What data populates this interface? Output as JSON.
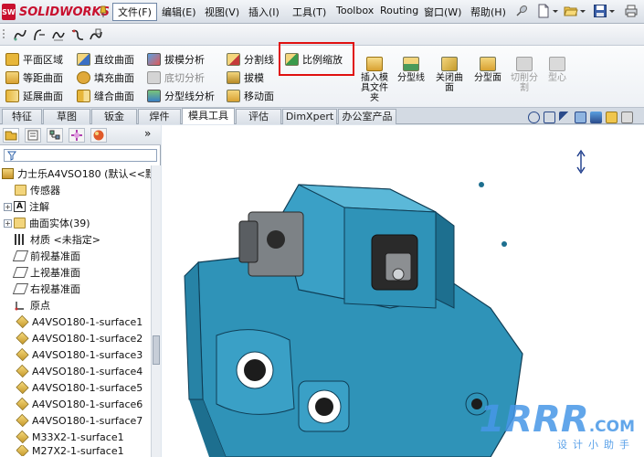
{
  "app": {
    "logo_text": "SOLIDWORKS",
    "logo_mark": "SW"
  },
  "menu": [
    {
      "label": "文件(F)",
      "active": true
    },
    {
      "label": "编辑(E)"
    },
    {
      "label": "视图(V)"
    },
    {
      "label": "插入(I)"
    },
    {
      "label": "工具(T)"
    },
    {
      "label": "Toolbox"
    },
    {
      "label": "Routing"
    },
    {
      "label": "窗口(W)"
    },
    {
      "label": "帮助(H)"
    }
  ],
  "commands": {
    "col1": [
      "平面区域",
      "等距曲面",
      "延展曲面"
    ],
    "col2": [
      "直纹曲面",
      "填充曲面",
      "缝合曲面"
    ],
    "col3": [
      "拔模分析",
      "底切分析",
      "分型线分析"
    ],
    "col4": [
      "分割线",
      "拔模",
      "移动面"
    ],
    "scale": "比例缩放",
    "vertical": [
      {
        "label": "插入模具文件夹",
        "lines": [
          "插入模",
          "具文件",
          "夹"
        ]
      },
      {
        "label": "分型线",
        "lines": [
          "分型线"
        ]
      },
      {
        "label": "关闭曲面",
        "lines": [
          "关闭曲",
          "面"
        ]
      },
      {
        "label": "分型面",
        "lines": [
          "分型面"
        ]
      },
      {
        "label": "切削分割",
        "lines": [
          "切削分",
          "割"
        ],
        "disabled": true
      },
      {
        "label": "型心",
        "lines": [
          "型心"
        ],
        "disabled": true
      }
    ]
  },
  "tabs": [
    "特征",
    "草图",
    "钣金",
    "焊件",
    "模具工具",
    "评估",
    "DimXpert",
    "办公室产品"
  ],
  "active_tab": "模具工具",
  "tree": {
    "root": "力士乐A4VSO180 (默认<<默",
    "items": [
      {
        "label": "传感器",
        "icon": "sensor-icon"
      },
      {
        "label": "注解",
        "icon": "annotation-icon",
        "expand": "+"
      },
      {
        "label": "曲面实体(39)",
        "icon": "folder-icon",
        "expand": "+"
      },
      {
        "label": "材质 <未指定>",
        "icon": "material-icon"
      },
      {
        "label": "前视基准面",
        "icon": "plane-icon"
      },
      {
        "label": "上视基准面",
        "icon": "plane-icon"
      },
      {
        "label": "右视基准面",
        "icon": "plane-icon"
      },
      {
        "label": "原点",
        "icon": "origin-icon"
      },
      {
        "label": "A4VSO180-1-surface1",
        "icon": "surface-icon"
      },
      {
        "label": "A4VSO180-1-surface2",
        "icon": "surface-icon"
      },
      {
        "label": "A4VSO180-1-surface3",
        "icon": "surface-icon"
      },
      {
        "label": "A4VSO180-1-surface4",
        "icon": "surface-icon"
      },
      {
        "label": "A4VSO180-1-surface5",
        "icon": "surface-icon"
      },
      {
        "label": "A4VSO180-1-surface6",
        "icon": "surface-icon"
      },
      {
        "label": "A4VSO180-1-surface7",
        "icon": "surface-icon"
      },
      {
        "label": "M33X2-1-surface1",
        "icon": "surface-icon"
      },
      {
        "label": "M27X2-1-surface1",
        "icon": "surface-icon"
      }
    ]
  },
  "watermark": {
    "big": "1RRR",
    "com": ".COM",
    "sub": "设计小助手"
  },
  "colors": {
    "model": "#2f93b8",
    "highlight": "#e01010",
    "brand": "#c8102e"
  }
}
